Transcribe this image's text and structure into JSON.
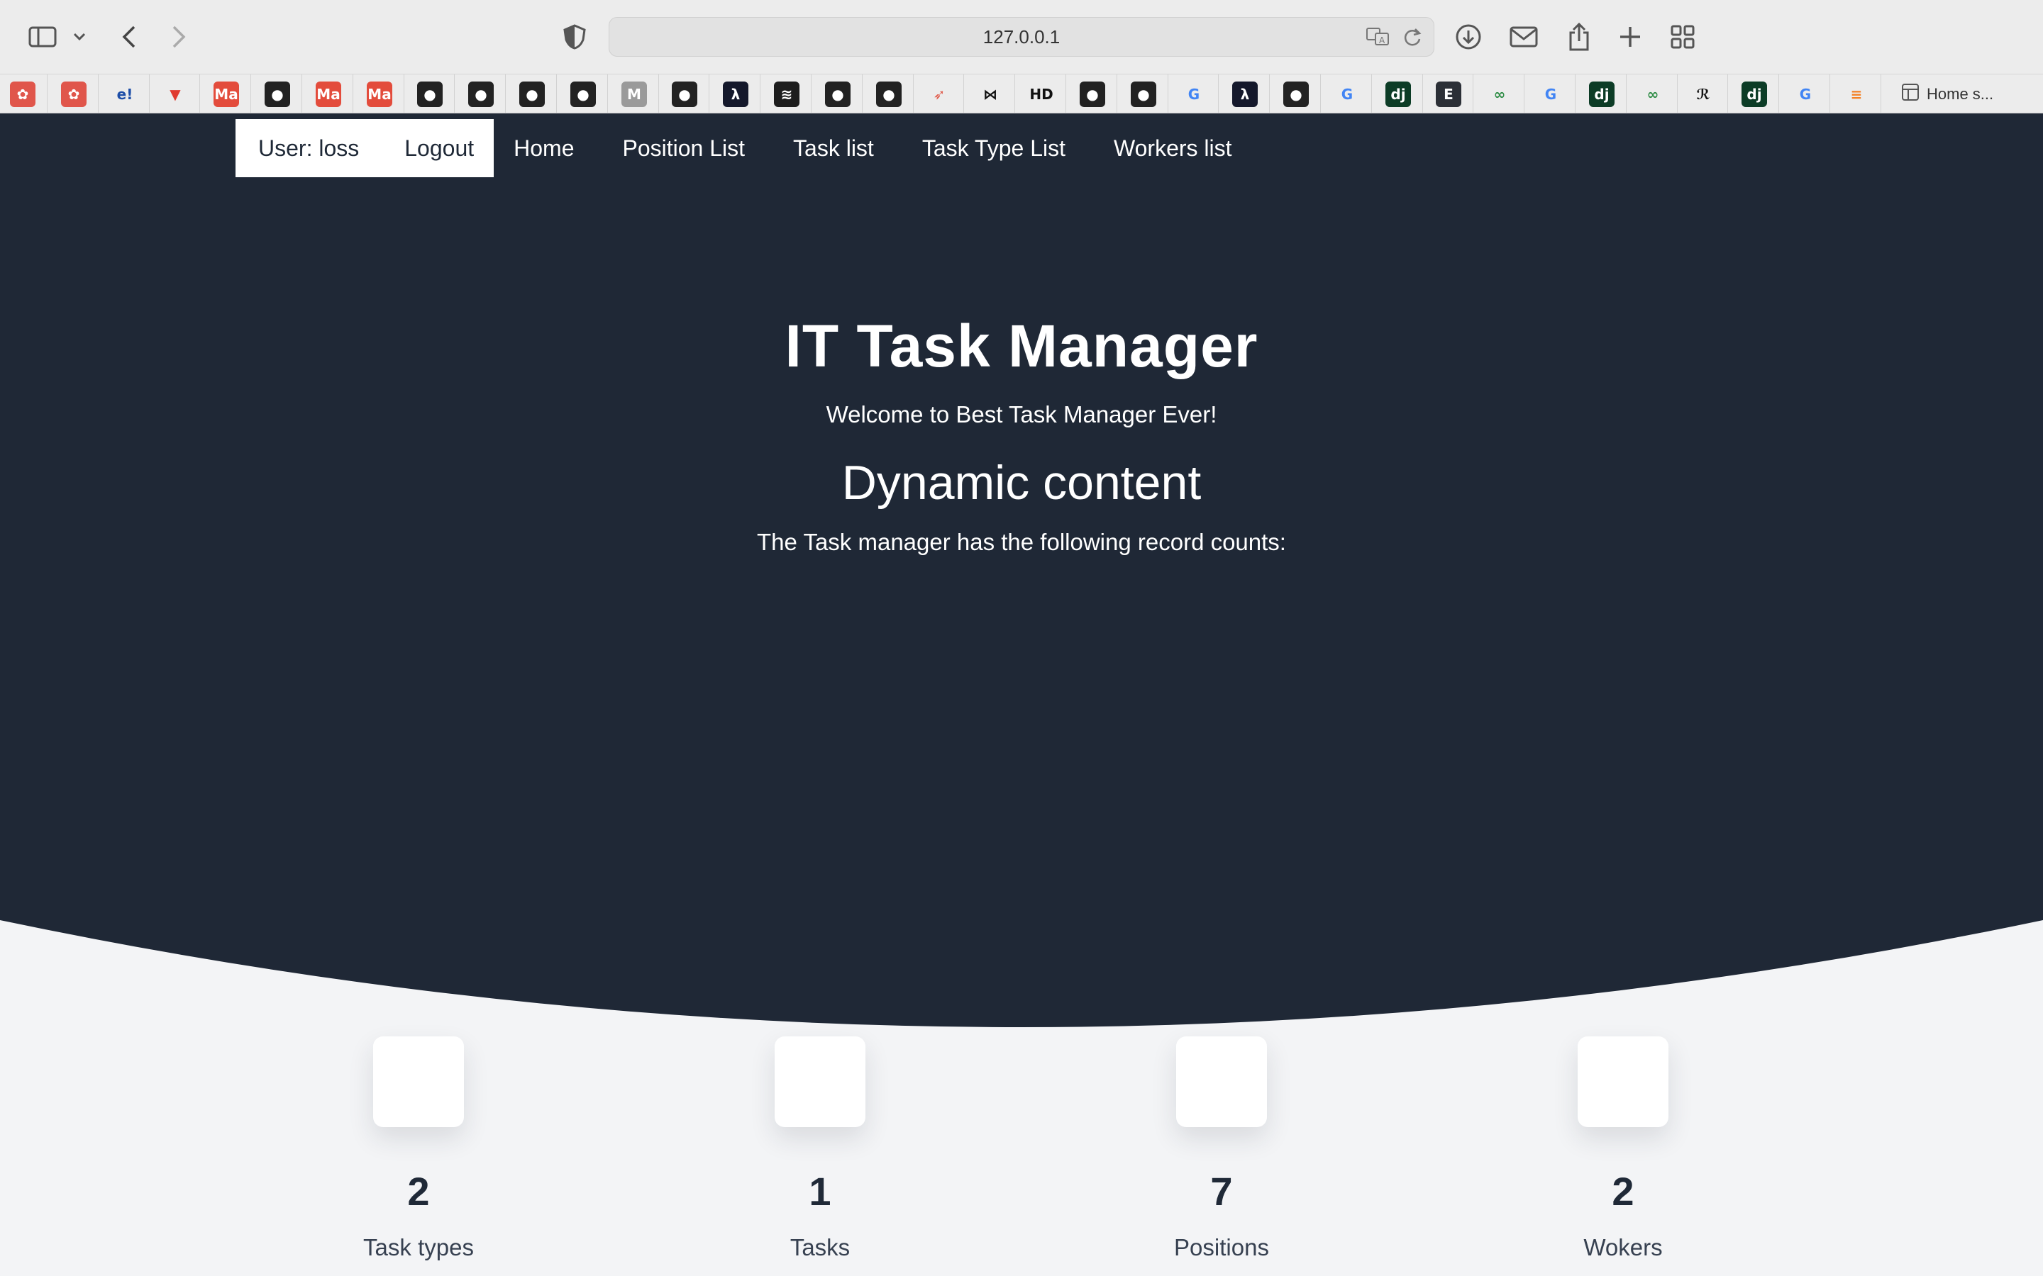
{
  "browser": {
    "url": "127.0.0.1",
    "bookmark_home_label": "Home s..."
  },
  "bookmarks": [
    {
      "name": "chatgpt-bookmark-icon",
      "color": "#e0564b",
      "glyph": "✿"
    },
    {
      "name": "chatgpt-bookmark-icon",
      "color": "#e0564b",
      "glyph": "✿"
    },
    {
      "name": "e-bookmark-icon",
      "color": "#ececec",
      "glyph": "e!",
      "fg": "#1d4ea8"
    },
    {
      "name": "t-bookmark-icon",
      "color": "#ececec",
      "glyph": "▼",
      "fg": "#e03a2f"
    },
    {
      "name": "ma-bookmark-icon",
      "color": "#e34c3c",
      "glyph": "Ma"
    },
    {
      "name": "github-bookmark-icon",
      "color": "#222",
      "glyph": "●"
    },
    {
      "name": "ma-bookmark-icon",
      "color": "#e34c3c",
      "glyph": "Ma"
    },
    {
      "name": "ma-bookmark-icon",
      "color": "#e34c3c",
      "glyph": "Ma"
    },
    {
      "name": "github-bookmark-icon",
      "color": "#222",
      "glyph": "●"
    },
    {
      "name": "github-bookmark-icon",
      "color": "#222",
      "glyph": "●"
    },
    {
      "name": "github-bookmark-icon",
      "color": "#222",
      "glyph": "●"
    },
    {
      "name": "github-bookmark-icon",
      "color": "#222",
      "glyph": "●"
    },
    {
      "name": "m-bookmark-icon",
      "color": "#9a9a9a",
      "glyph": "M"
    },
    {
      "name": "github-bookmark-icon",
      "color": "#222",
      "glyph": "●"
    },
    {
      "name": "lambda-bookmark-icon",
      "color": "#14182b",
      "glyph": "λ"
    },
    {
      "name": "stack-bookmark-icon",
      "color": "#1d1d1d",
      "glyph": "≋"
    },
    {
      "name": "github-bookmark-icon",
      "color": "#222",
      "glyph": "●"
    },
    {
      "name": "github-bookmark-icon",
      "color": "#222",
      "glyph": "●"
    },
    {
      "name": "rocket-bookmark-icon",
      "color": "#ececec",
      "glyph": "➶",
      "fg": "#e05a4a"
    },
    {
      "name": "bowtie-bookmark-icon",
      "color": "#ececec",
      "glyph": "⋈",
      "fg": "#111"
    },
    {
      "name": "hd-bookmark-icon",
      "color": "#ececec",
      "glyph": "HD",
      "fg": "#111"
    },
    {
      "name": "github-bookmark-icon",
      "color": "#222",
      "glyph": "●"
    },
    {
      "name": "github-bookmark-icon",
      "color": "#222",
      "glyph": "●"
    },
    {
      "name": "google-bookmark-icon",
      "color": "#ececec",
      "glyph": "G",
      "fg": "#4285f4"
    },
    {
      "name": "lambda-bookmark-icon",
      "color": "#14182b",
      "glyph": "λ"
    },
    {
      "name": "github-bookmark-icon",
      "color": "#222",
      "glyph": "●"
    },
    {
      "name": "google-bookmark-icon",
      "color": "#ececec",
      "glyph": "G",
      "fg": "#4285f4"
    },
    {
      "name": "django-bookmark-icon",
      "color": "#0c3c26",
      "glyph": "dj"
    },
    {
      "name": "e-dark-bookmark-icon",
      "color": "#2b2f36",
      "glyph": "E"
    },
    {
      "name": "geeks-bookmark-icon",
      "color": "#ececec",
      "glyph": "∞",
      "fg": "#2f8d46"
    },
    {
      "name": "google-bookmark-icon",
      "color": "#ececec",
      "glyph": "G",
      "fg": "#4285f4"
    },
    {
      "name": "django-bookmark-icon",
      "color": "#0c3c26",
      "glyph": "dj"
    },
    {
      "name": "geeks-bookmark-icon",
      "color": "#ececec",
      "glyph": "∞",
      "fg": "#2f8d46"
    },
    {
      "name": "pe-bookmark-icon",
      "color": "#ececec",
      "glyph": "ℛ",
      "fg": "#111"
    },
    {
      "name": "django-bookmark-icon",
      "color": "#0c3c26",
      "glyph": "dj"
    },
    {
      "name": "google-bookmark-icon",
      "color": "#ececec",
      "glyph": "G",
      "fg": "#4285f4"
    },
    {
      "name": "stackoverflow-bookmark-icon",
      "color": "#ececec",
      "glyph": "≡",
      "fg": "#f48024"
    }
  ],
  "nav": {
    "user_label": "User: loss",
    "logout_label": "Logout",
    "links": [
      "Home",
      "Position List",
      "Task list",
      "Task Type List",
      "Workers list"
    ]
  },
  "hero": {
    "title": "IT Task Manager",
    "subtitle": "Welcome to Best Task Manager Ever!",
    "heading": "Dynamic content",
    "description": "The Task manager has the following record counts:"
  },
  "stats": [
    {
      "value": "2",
      "label": "Task types"
    },
    {
      "value": "1",
      "label": "Tasks"
    },
    {
      "value": "7",
      "label": "Positions"
    },
    {
      "value": "2",
      "label": "Wokers"
    }
  ],
  "colors": {
    "hero_bg": "#1f2836",
    "page_bg": "#f3f4f6",
    "text_dark": "#1f2937"
  }
}
